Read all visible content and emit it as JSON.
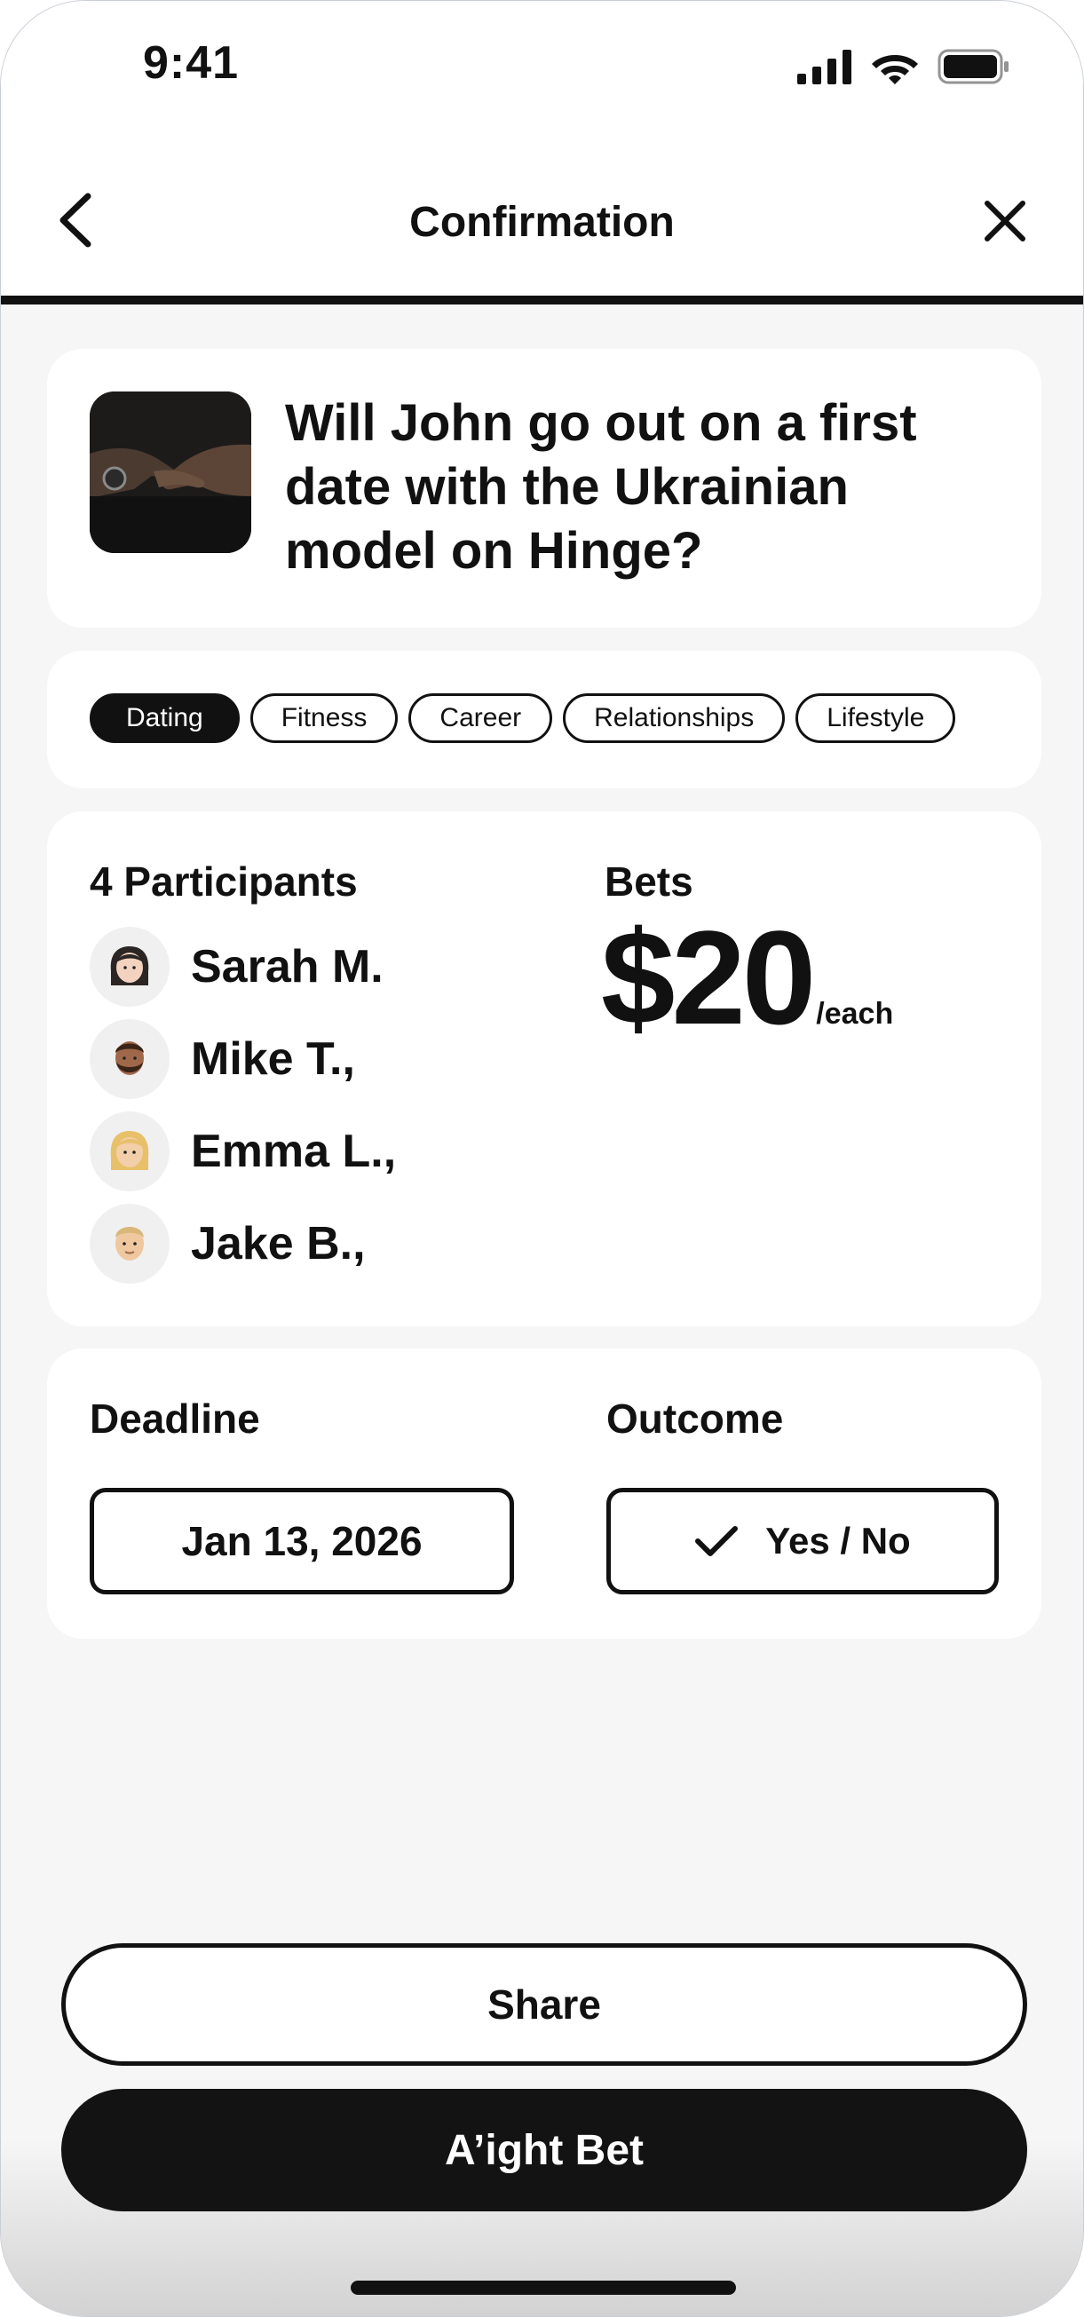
{
  "status_bar": {
    "time": "9:41",
    "icons": [
      "signal-icon",
      "wifi-icon",
      "battery-icon"
    ]
  },
  "header": {
    "title": "Confirmation",
    "back_icon": "chevron-left-icon",
    "close_icon": "close-icon"
  },
  "bet": {
    "question": "Will John go out on a first date with the Ukrainian model on Hinge?",
    "thumbnail": "handshake-photo"
  },
  "categories": {
    "selected": "Dating",
    "items": [
      {
        "label": "Dating",
        "active": true
      },
      {
        "label": "Fitness",
        "active": false
      },
      {
        "label": "Career",
        "active": false
      },
      {
        "label": "Relationships",
        "active": false
      },
      {
        "label": "Lifestyle",
        "active": false
      }
    ]
  },
  "participants": {
    "title": "4 Participants",
    "list": [
      {
        "name": "Sarah M.",
        "avatar": "woman-dark-hair-avatar"
      },
      {
        "name": "Mike T.,",
        "avatar": "man-beard-avatar"
      },
      {
        "name": "Emma L.,",
        "avatar": "woman-blonde-avatar"
      },
      {
        "name": "Jake B.,",
        "avatar": "man-blonde-avatar"
      }
    ]
  },
  "bets": {
    "title": "Bets",
    "amount": "$20",
    "unit": "/each"
  },
  "deadline": {
    "label": "Deadline",
    "value": "Jan 13, 2026"
  },
  "outcome": {
    "label": "Outcome",
    "value": "Yes / No",
    "icon": "checkmark-icon"
  },
  "actions": {
    "share_label": "Share",
    "confirm_label": "A’ight Bet"
  },
  "colors": {
    "background": "#f6f6f6",
    "card": "#ffffff",
    "ink": "#111111"
  }
}
